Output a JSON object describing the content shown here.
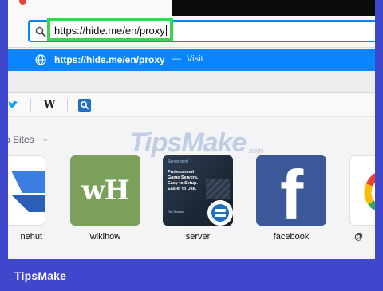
{
  "address_bar": {
    "value": "https://hide.me/en/proxy"
  },
  "suggestion": {
    "url": "https://hide.me/en/proxy",
    "separator": "—",
    "action": "Visit"
  },
  "bookmarks": {
    "items": [
      "twitter-icon",
      "wikipedia-w-icon",
      "search-icon"
    ],
    "wiki_letter": "W"
  },
  "new_tab": {
    "top_sites_label": "p Sites",
    "top_sites": [
      {
        "label": "nehut",
        "icon": "pushpin-logo"
      },
      {
        "label": "wikihow",
        "icon": "wikihow-logo",
        "logo_text": "wH"
      },
      {
        "label": "server",
        "icon": "server-preview",
        "preview_title": "Professional Game Servers. Easy to Setup. Easier to Use.",
        "preview_brand": "Serverpoint",
        "preview_button": "Get Started"
      },
      {
        "label": "facebook",
        "icon": "facebook-logo",
        "logo_text": "f"
      },
      {
        "label": "@",
        "icon": "google-logo"
      }
    ]
  },
  "watermark": {
    "text": "TipsMake",
    "sub": ".com"
  },
  "footer": {
    "brand": "TipsMake"
  },
  "colors": {
    "frame": "#3f48cc",
    "highlight": "#3dd34b",
    "accent": "#0a84ff",
    "facebook": "#3b5998",
    "wikihow": "#7aa05a"
  }
}
